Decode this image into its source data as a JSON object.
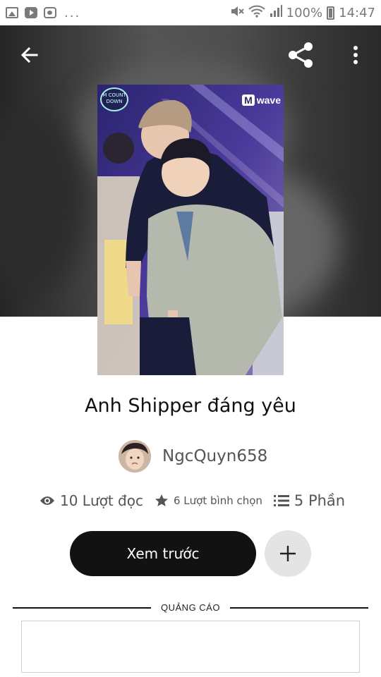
{
  "status_bar": {
    "more": "...",
    "battery_percent": "100%",
    "time": "14:47",
    "icons": [
      "photo-icon",
      "youtube-icon",
      "message-icon",
      "mute-icon",
      "wifi-icon",
      "signal-icon",
      "battery-icon"
    ]
  },
  "toolbar": {
    "back_icon": "arrow-left-icon",
    "share_icon": "share-icon",
    "more_icon": "more-vertical-icon"
  },
  "cover": {
    "logo_text": "M COUNT DOWN",
    "brand_mark": "M",
    "brand_text": "wave"
  },
  "story": {
    "title": "Anh Shipper đáng yêu",
    "author": "NgcQuyn658"
  },
  "stats": {
    "reads": "10 Lượt đọc",
    "votes": "6 Lượt bình chọn",
    "parts": "5 Phần"
  },
  "actions": {
    "preview_label": "Xem trước",
    "add_icon": "plus-icon"
  },
  "ad": {
    "label": "QUẢNG CÁO"
  },
  "colors": {
    "button_dark": "#121212",
    "add_button_bg": "#e4e4e4",
    "text_muted": "#555555"
  }
}
